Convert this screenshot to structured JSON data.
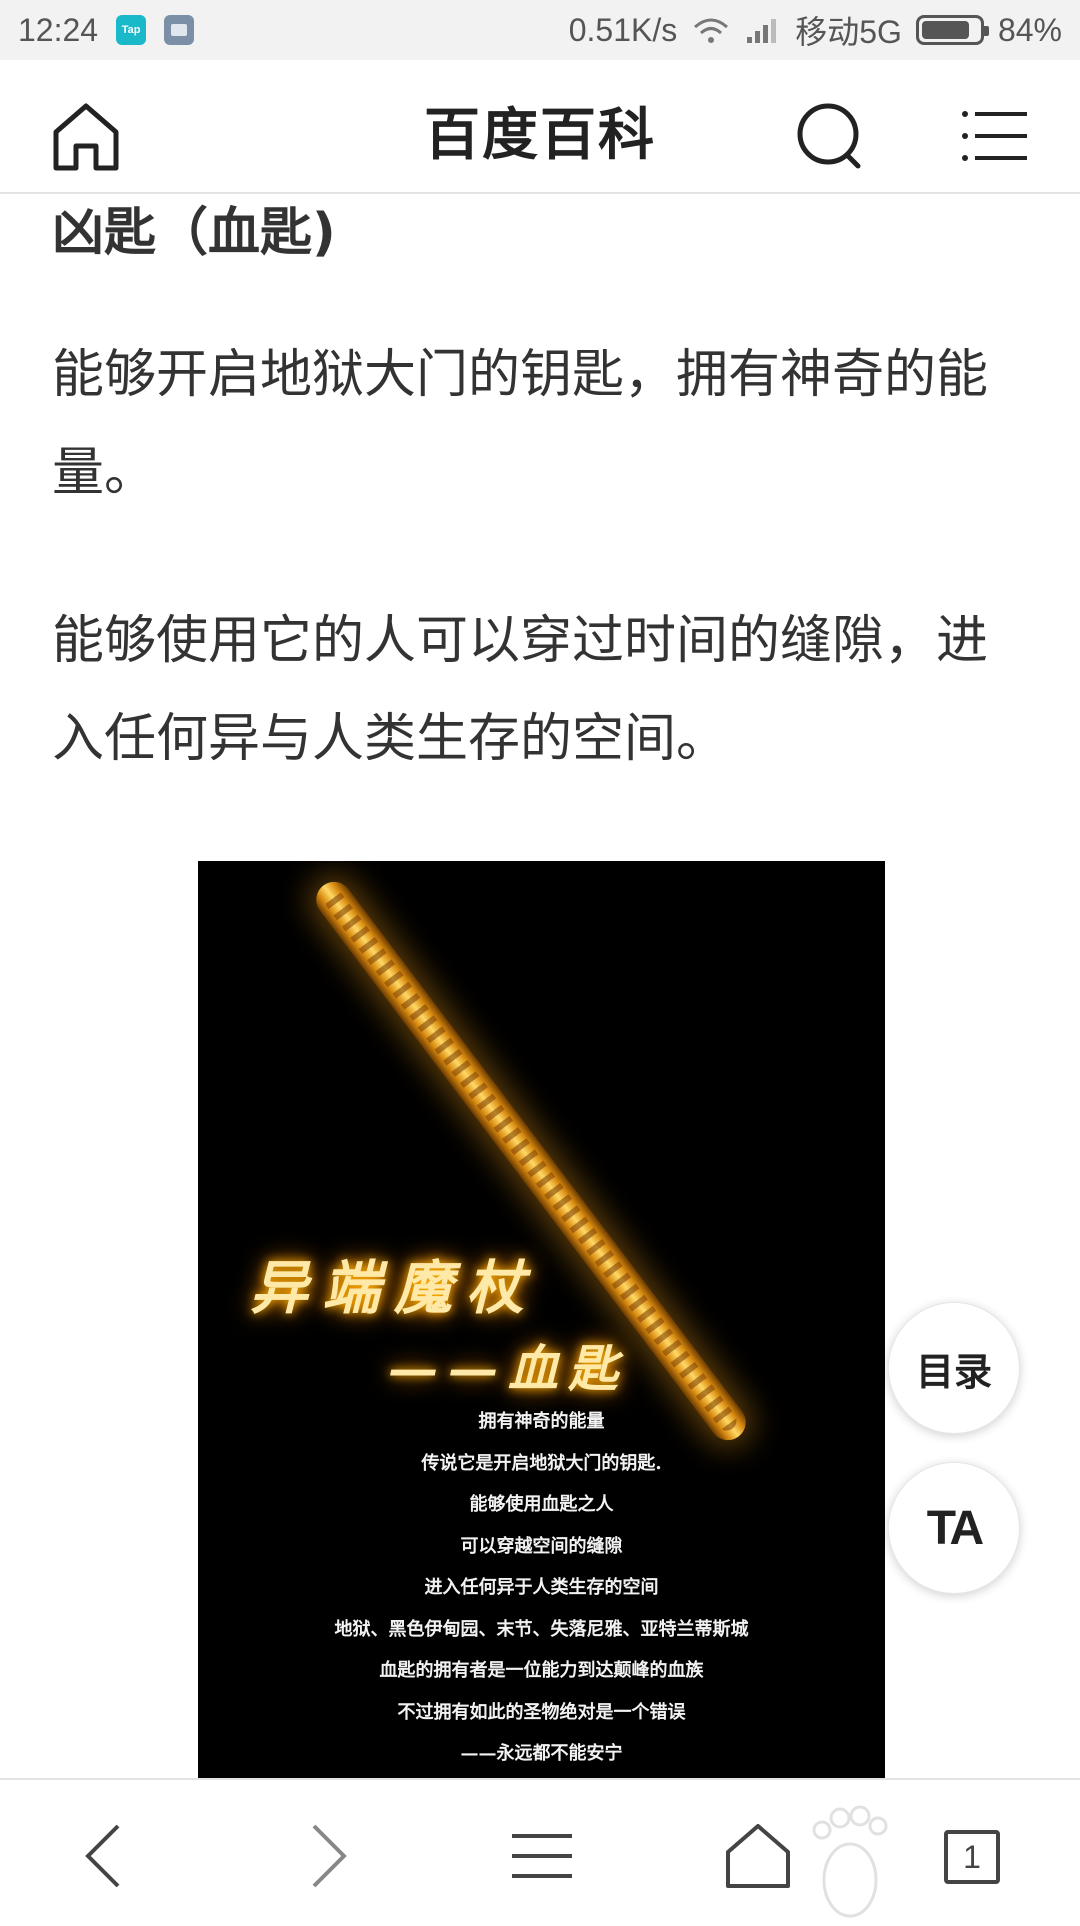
{
  "status_bar": {
    "time": "12:24",
    "app_icons": [
      "Tap",
      "message-icon"
    ],
    "network_speed": "0.51K/s",
    "carrier": "移动5G",
    "battery": "84%"
  },
  "header": {
    "title": "百度百科",
    "icons": [
      "home-icon",
      "search-icon",
      "menu-icon"
    ]
  },
  "article": {
    "section_title": "凶匙（血匙)",
    "paragraphs": [
      "能够开启地狱大门的钥匙，拥有神奇的能量。",
      "能够使用它的人可以穿过时间的缝隙，进入任何异与人类生存的空间。"
    ]
  },
  "image": {
    "title": "异端魔杖",
    "subtitle": "——血匙",
    "lines": [
      "拥有神奇的能量",
      "传说它是开启地狱大门的钥匙.",
      "能够使用血匙之人",
      "可以穿越空间的缝隙",
      "进入任何异于人类生存的空间",
      "地狱、黑色伊甸园、末节、失落尼雅、亚特兰蒂斯城",
      "血匙的拥有者是一位能力到达颠峰的血族",
      "不过拥有如此的圣物绝对是一个错误",
      "——永远都不能安宁"
    ]
  },
  "floating": {
    "toc_label": "目录",
    "ta_label": "TA"
  },
  "bottom_bar": {
    "icons": [
      "back-icon",
      "forward-icon",
      "menu-icon",
      "home-icon",
      "tabs-icon"
    ],
    "tab_count": "1"
  },
  "colors": {
    "status_bg": "#f2f2f2",
    "text": "#333333",
    "poster_glow": "#ffb000",
    "badge_tap": "#19b9c9"
  }
}
